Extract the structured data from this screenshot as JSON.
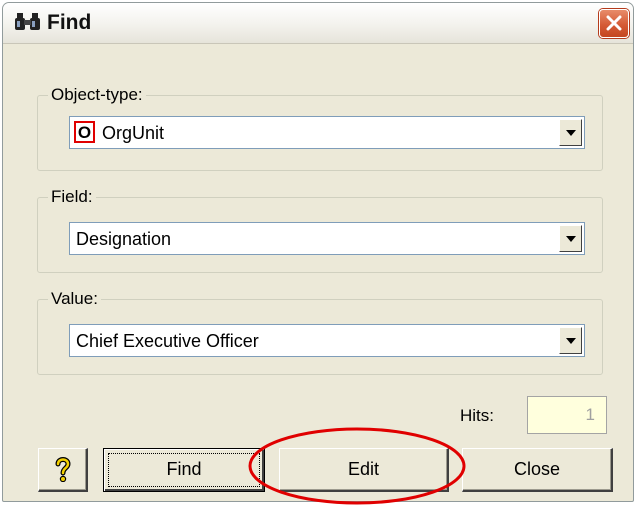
{
  "window": {
    "title": "Find",
    "title_icon": "binoculars-icon",
    "close_icon": "close-icon"
  },
  "object_type": {
    "label": "Object-type:",
    "badge": "O",
    "value": "OrgUnit"
  },
  "field": {
    "label": "Field:",
    "value": "Designation"
  },
  "value": {
    "label": "Value:",
    "value": "Chief Executive Officer"
  },
  "hits": {
    "label": "Hits:",
    "value": "1"
  },
  "buttons": {
    "help_icon": "help-icon",
    "find": "Find",
    "edit": "Edit",
    "close": "Close"
  },
  "colors": {
    "annotation": "#e00000",
    "close_button": "#d55b36",
    "hits_bg": "#ffffdd"
  }
}
